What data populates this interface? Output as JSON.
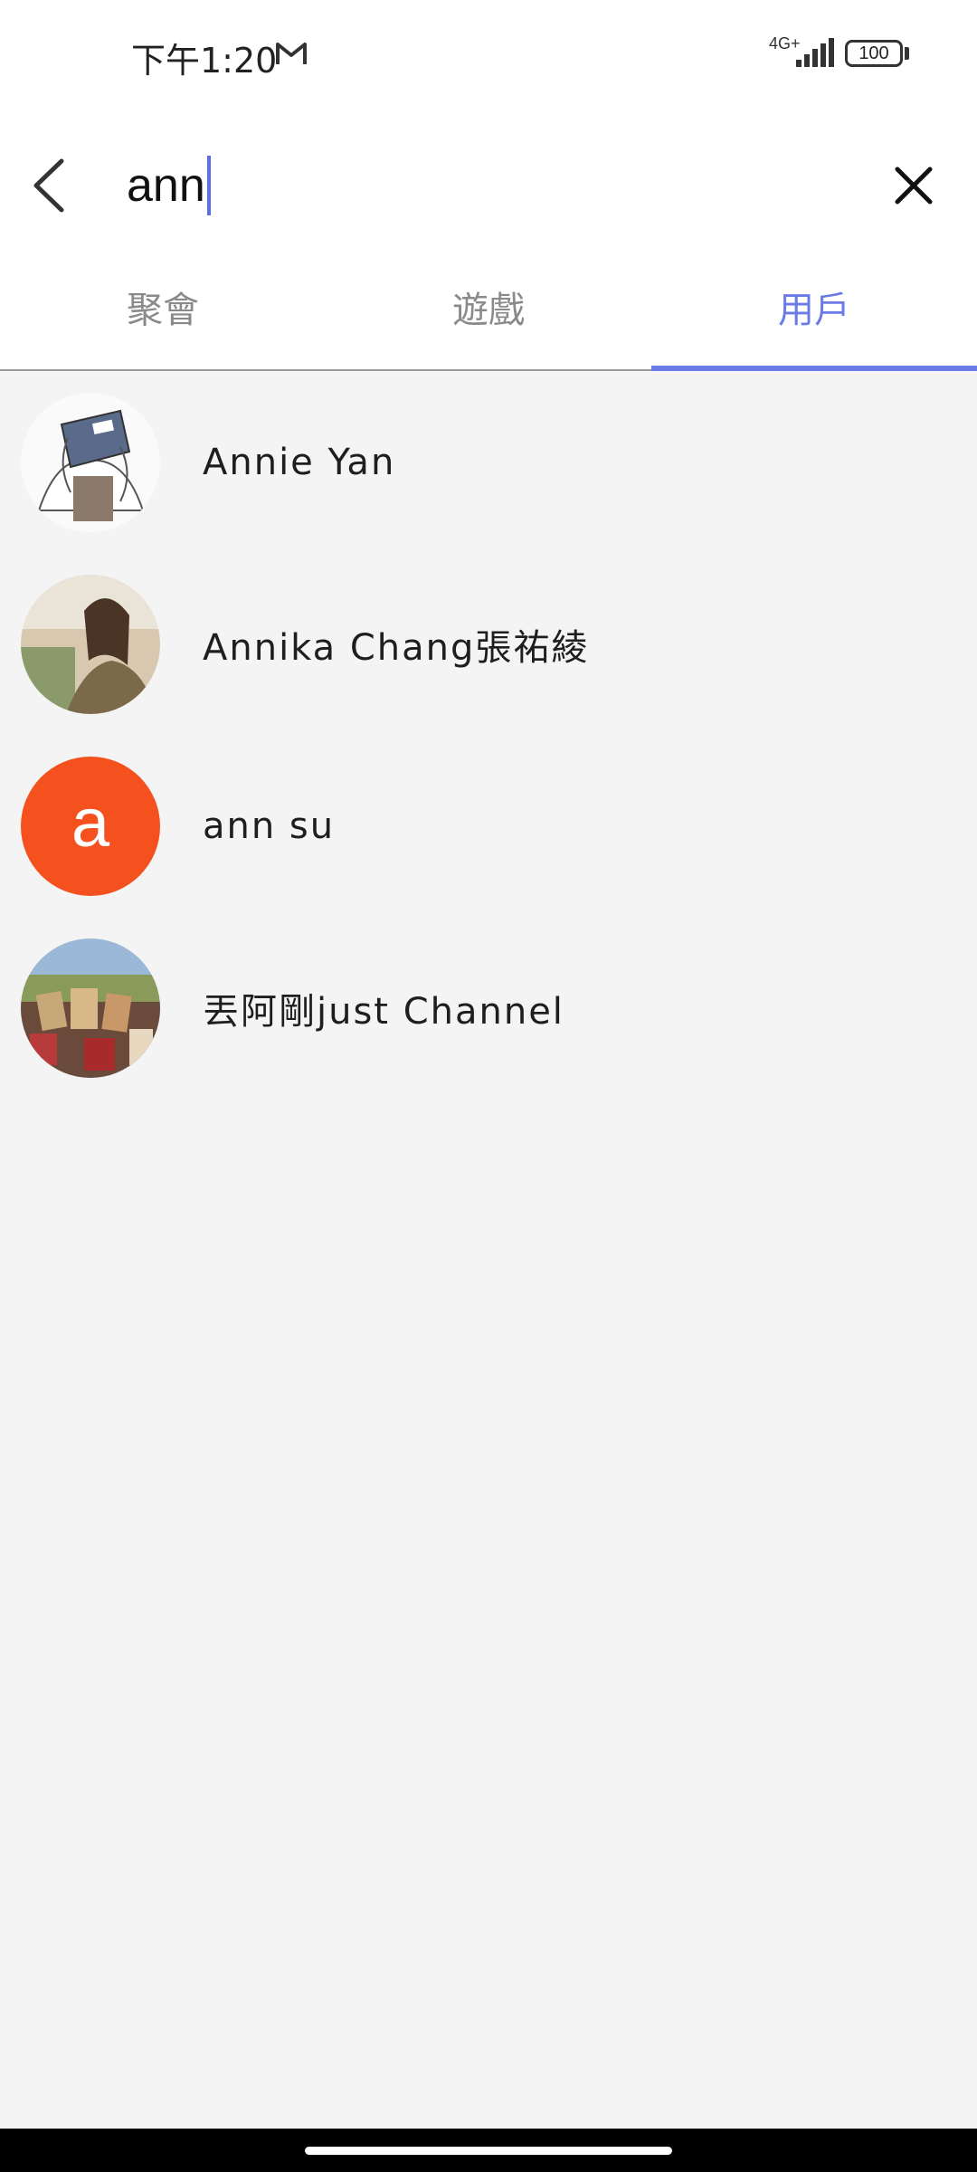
{
  "status_bar": {
    "time": "下午1:20",
    "network": "4G+",
    "battery": "100",
    "icons": [
      "gmail-icon",
      "signal-icon",
      "battery-icon"
    ]
  },
  "search": {
    "query": "ann",
    "back_icon": "chevron-left-icon",
    "clear_icon": "close-icon",
    "caret_color": "#5b6ee8"
  },
  "tabs": [
    {
      "label": "聚會",
      "active": false
    },
    {
      "label": "遊戲",
      "active": false
    },
    {
      "label": "用戶",
      "active": true
    }
  ],
  "accent_color": "#6a7be5",
  "users": [
    {
      "name": "Annie Yan",
      "avatar": "illustration-avatar"
    },
    {
      "name": "Annika Chang張祐綾",
      "avatar": "photo-avatar"
    },
    {
      "name": "ann su",
      "avatar": "letter-avatar",
      "avatar_letter": "a",
      "avatar_color": "#f4511e"
    },
    {
      "name": "丟阿剛just Channel",
      "avatar": "photo-avatar"
    }
  ]
}
